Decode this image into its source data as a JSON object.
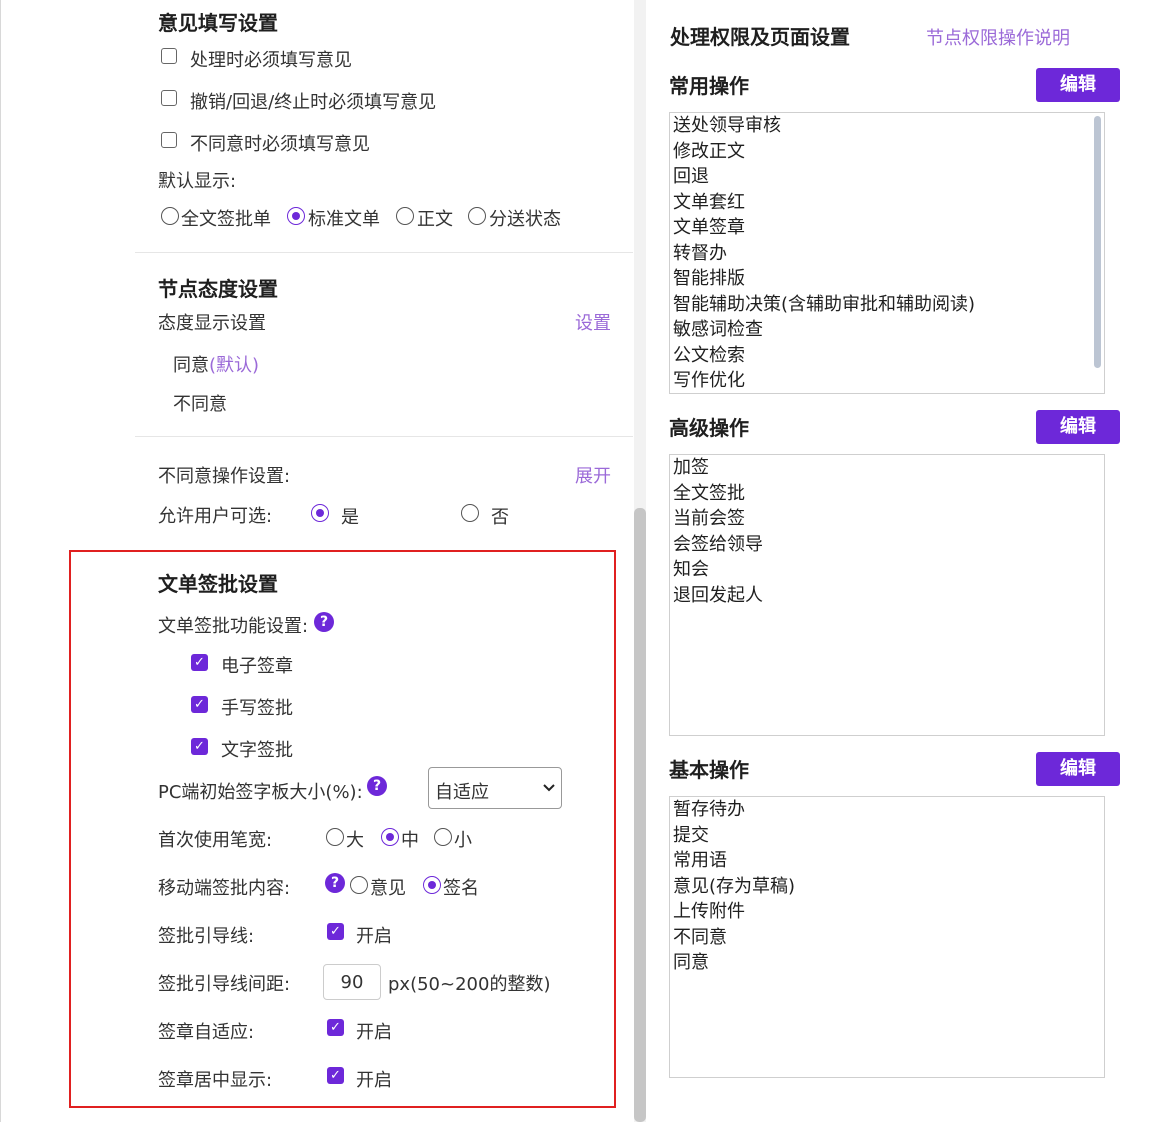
{
  "opinion": {
    "title": "意见填写设置",
    "checks": [
      "处理时必须填写意见",
      "撤销/回退/终止时必须填写意见",
      "不同意时必须填写意见"
    ],
    "default_label": "默认显示:",
    "default_options": [
      "全文签批单",
      "标准文单",
      "正文",
      "分送状态"
    ],
    "default_selected": "标准文单"
  },
  "attitude": {
    "title": "节点态度设置",
    "display_label": "态度显示设置",
    "set_link": "设置",
    "agree": "同意",
    "agree_default": "(默认)",
    "disagree": "不同意"
  },
  "disagree_ops": {
    "label": "不同意操作设置:",
    "expand_link": "展开",
    "allow_label": "允许用户可选:",
    "yes": "是",
    "no": "否",
    "selected": "是"
  },
  "sign": {
    "title": "文单签批设置",
    "func_label": "文单签批功能设置:",
    "help": "?",
    "funcs": [
      "电子签章",
      "手写签批",
      "文字签批"
    ],
    "pc_size_label": "PC端初始签字板大小(%):",
    "pc_size_value": "自适应",
    "pen_label": "首次使用笔宽:",
    "pen_options": [
      "大",
      "中",
      "小"
    ],
    "pen_selected": "中",
    "mobile_label": "移动端签批内容:",
    "mobile_options": [
      "意见",
      "签名"
    ],
    "mobile_selected": "签名",
    "guide_label": "签批引导线:",
    "guide_value": "开启",
    "spacing_label": "签批引导线间距:",
    "spacing_value": "90",
    "spacing_unit": "px(50~200的整数)",
    "adaptive_label": "签章自适应:",
    "adaptive_value": "开启",
    "center_label": "签章居中显示:",
    "center_value": "开启"
  },
  "right": {
    "title": "处理权限及页面设置",
    "help_link": "节点权限操作说明",
    "edit_label": "编辑",
    "common_title": "常用操作",
    "common_items": [
      "送处领导审核",
      "修改正文",
      "回退",
      "文单套红",
      "文单签章",
      "转督办",
      "智能排版",
      "智能辅助决策(含辅助审批和辅助阅读)",
      "敏感词检查",
      "公文检索",
      "写作优化"
    ],
    "advanced_title": "高级操作",
    "advanced_items": [
      "加签",
      "全文签批",
      "当前会签",
      "会签给领导",
      "知会",
      "退回发起人"
    ],
    "basic_title": "基本操作",
    "basic_items": [
      "暂存待办",
      "提交",
      "常用语",
      "意见(存为草稿)",
      "上传附件",
      "不同意",
      "同意"
    ]
  },
  "colors": {
    "accent": "#6d28d9",
    "link": "#9b6ad8",
    "highlight_border": "#e02020"
  }
}
